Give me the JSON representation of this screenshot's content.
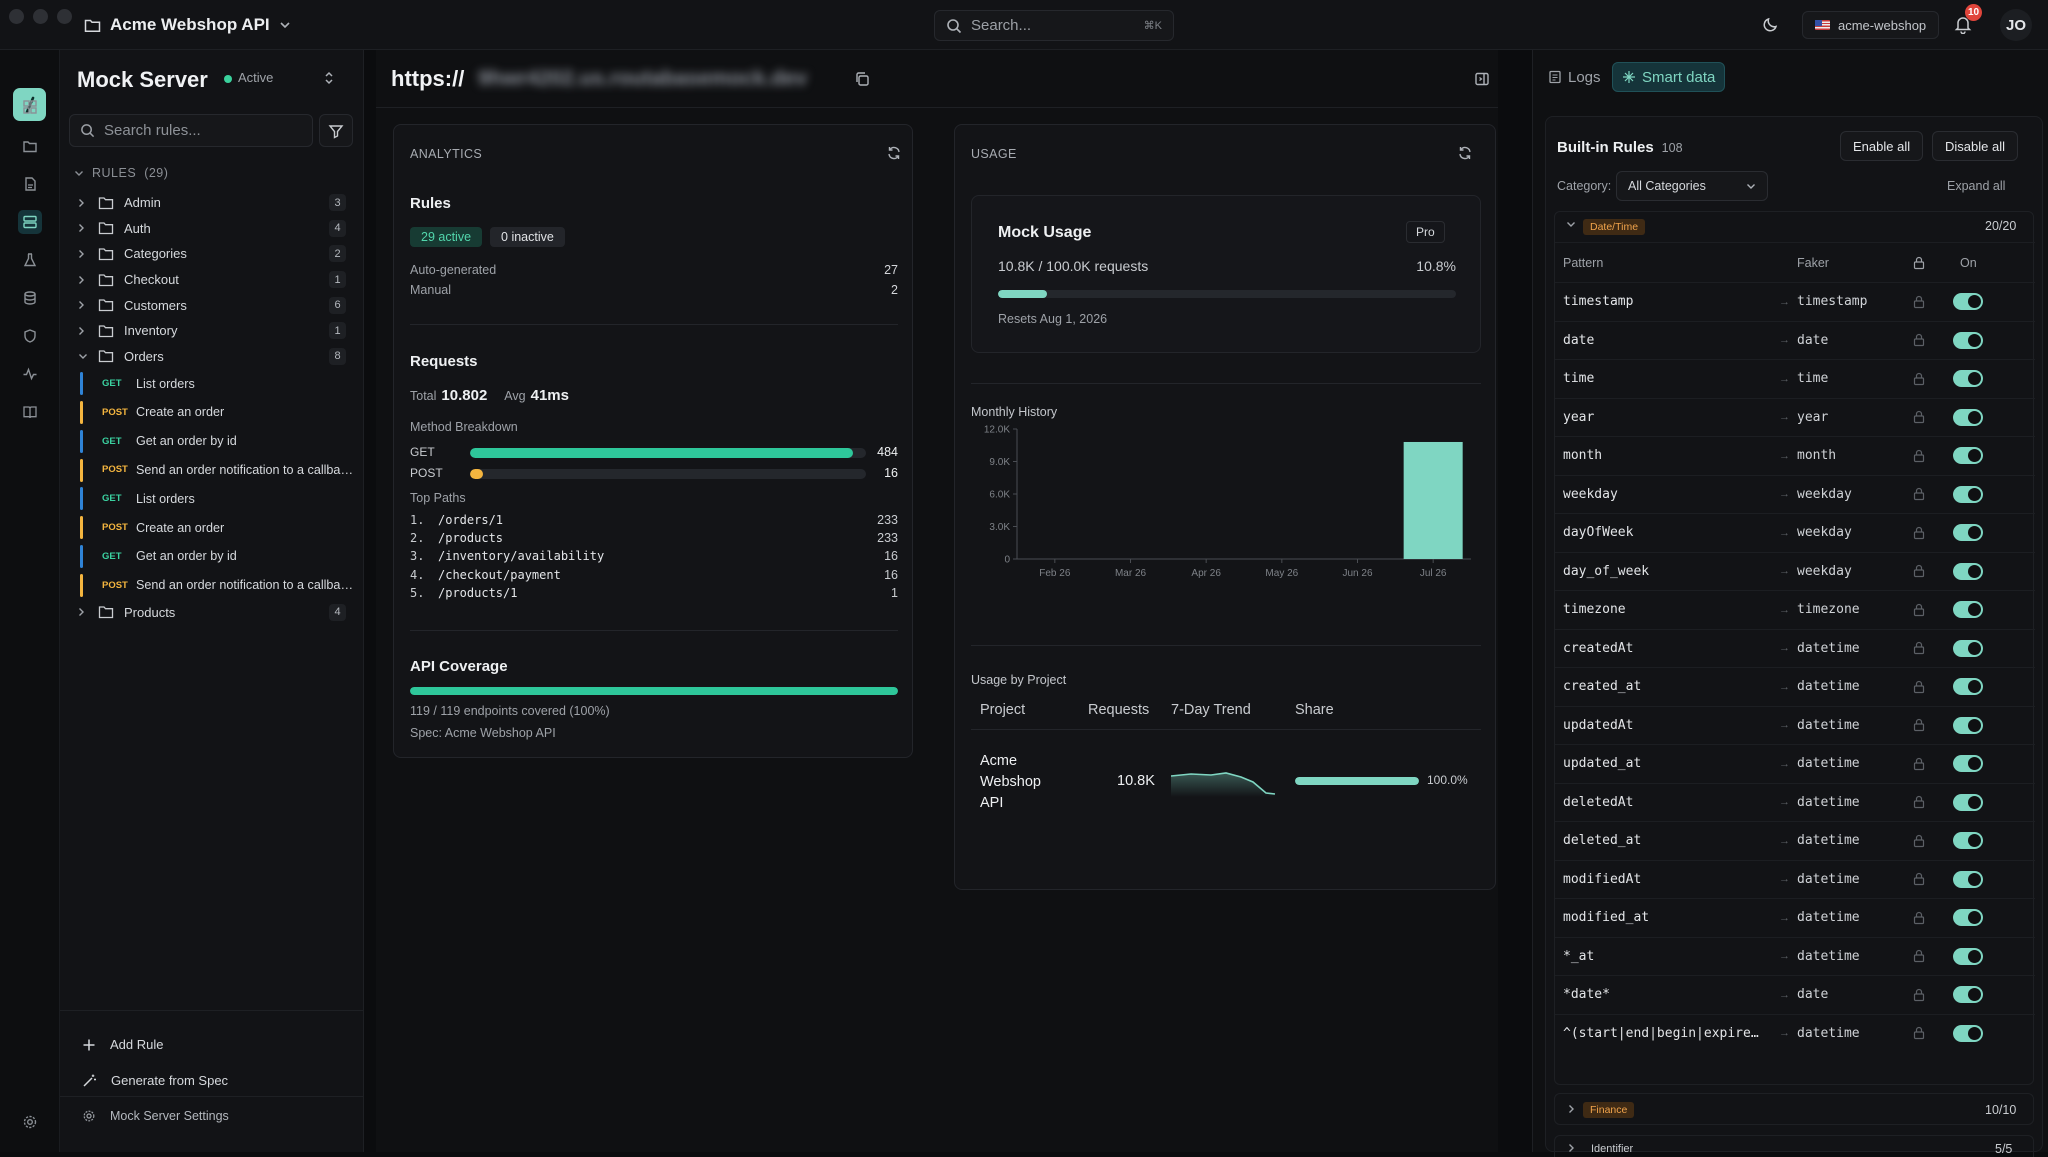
{
  "app": {
    "title": "Acme Webshop API"
  },
  "search": {
    "placeholder": "Search...",
    "shortcut": "⌘K"
  },
  "header": {
    "workspace": "acme-webshop",
    "notifications": "10",
    "avatar": "JO"
  },
  "sidebar": {
    "server_name": "Mock Server",
    "status": "Active",
    "search_placeholder": "Search rules...",
    "rules_label": "RULES",
    "rules_count": "(29)",
    "folders_top": [
      {
        "name": "Admin",
        "count": "3"
      },
      {
        "name": "Auth",
        "count": "4"
      },
      {
        "name": "Categories",
        "count": "2"
      },
      {
        "name": "Checkout",
        "count": "1"
      },
      {
        "name": "Customers",
        "count": "6"
      },
      {
        "name": "Inventory",
        "count": "1"
      },
      {
        "name": "Orders",
        "count": "8"
      }
    ],
    "order_rules": [
      {
        "method": "GET",
        "name": "List orders"
      },
      {
        "method": "POST",
        "name": "Create an order"
      },
      {
        "method": "GET",
        "name": "Get an order by id"
      },
      {
        "method": "POST",
        "name": "Send an order notification to a callback URL"
      },
      {
        "method": "GET",
        "name": "List orders"
      },
      {
        "method": "POST",
        "name": "Create an order"
      },
      {
        "method": "GET",
        "name": "Get an order by id"
      },
      {
        "method": "POST",
        "name": "Send an order notification to a callback URL"
      }
    ],
    "folders_bottom": [
      {
        "name": "Products",
        "count": "4"
      }
    ],
    "add_rule": "Add Rule",
    "generate": "Generate from Spec",
    "settings": "Mock Server Settings"
  },
  "url": {
    "prefix": "https://",
    "host": "9hwr4202.us.routabasemock.dev"
  },
  "analytics": {
    "caption": "ANALYTICS",
    "rules_title": "Rules",
    "active": "29 active",
    "inactive": "0 inactive",
    "auto_label": "Auto-generated",
    "auto_value": "27",
    "manual_label": "Manual",
    "manual_value": "2",
    "requests_title": "Requests",
    "total_label": "Total",
    "total_value": "10.802",
    "avg_label": "Avg",
    "avg_value": "41ms",
    "breakdown_label": "Method Breakdown",
    "methods": [
      {
        "name": "GET",
        "value": "484",
        "pct": 0.968,
        "color": "#2ec79a"
      },
      {
        "name": "POST",
        "value": "16",
        "pct": 0.032,
        "color": "#f4b53f"
      }
    ],
    "top_paths_label": "Top Paths",
    "top_paths": [
      {
        "rank": "1.",
        "path": "/orders/1",
        "count": "233"
      },
      {
        "rank": "2.",
        "path": "/products",
        "count": "233"
      },
      {
        "rank": "3.",
        "path": "/inventory/availability",
        "count": "16"
      },
      {
        "rank": "4.",
        "path": "/checkout/payment",
        "count": "16"
      },
      {
        "rank": "5.",
        "path": "/products/1",
        "count": "1"
      }
    ],
    "coverage_title": "API Coverage",
    "coverage_pct": 1.0,
    "coverage_text": "119 / 119 endpoints covered (100%)",
    "spec_text": "Spec: Acme Webshop API"
  },
  "usage": {
    "caption": "USAGE",
    "mock_title": "Mock Usage",
    "plan": "Pro",
    "requests_text": "10.8K / 100.0K requests",
    "pct_text": "10.8%",
    "pct": 0.108,
    "resets": "Resets Aug 1, 2026",
    "history_title": "Monthly History",
    "by_project_title": "Usage by Project",
    "columns": [
      "Project",
      "Requests",
      "7-Day Trend",
      "Share"
    ],
    "project": {
      "name_lines": [
        "Acme",
        "Webshop",
        "API"
      ],
      "requests": "10.8K",
      "share_text": "100.0%",
      "share": 1.0
    }
  },
  "chart_data": {
    "type": "bar",
    "title": "Monthly History",
    "categories": [
      "Feb 26",
      "Mar 26",
      "Apr 26",
      "May 26",
      "Jun 26",
      "Jul 26"
    ],
    "values": [
      0,
      0,
      0,
      0,
      0,
      10802
    ],
    "yticks": [
      "0",
      "3.0K",
      "6.0K",
      "9.0K",
      "12.0K"
    ],
    "ylim": [
      0,
      12000
    ],
    "color": "#7fd6c2",
    "grid": false
  },
  "right": {
    "tab_logs": "Logs",
    "tab_smart": "Smart data",
    "title": "Built-in Rules",
    "count": "108",
    "enable_all": "Enable all",
    "disable_all": "Disable all",
    "category_label": "Category:",
    "category_value": "All Categories",
    "expand_all": "Expand all",
    "group_open": {
      "name": "Date/Time",
      "count": "20/20"
    },
    "headers": {
      "pattern": "Pattern",
      "faker": "Faker",
      "on": "On"
    },
    "rows": [
      {
        "pattern": "timestamp",
        "faker": "timestamp"
      },
      {
        "pattern": "date",
        "faker": "date"
      },
      {
        "pattern": "time",
        "faker": "time"
      },
      {
        "pattern": "year",
        "faker": "year"
      },
      {
        "pattern": "month",
        "faker": "month"
      },
      {
        "pattern": "weekday",
        "faker": "weekday"
      },
      {
        "pattern": "dayOfWeek",
        "faker": "weekday"
      },
      {
        "pattern": "day_of_week",
        "faker": "weekday"
      },
      {
        "pattern": "timezone",
        "faker": "timezone"
      },
      {
        "pattern": "createdAt",
        "faker": "datetime"
      },
      {
        "pattern": "created_at",
        "faker": "datetime"
      },
      {
        "pattern": "updatedAt",
        "faker": "datetime"
      },
      {
        "pattern": "updated_at",
        "faker": "datetime"
      },
      {
        "pattern": "deletedAt",
        "faker": "datetime"
      },
      {
        "pattern": "deleted_at",
        "faker": "datetime"
      },
      {
        "pattern": "modifiedAt",
        "faker": "datetime"
      },
      {
        "pattern": "modified_at",
        "faker": "datetime"
      },
      {
        "pattern": "*_at",
        "faker": "datetime"
      },
      {
        "pattern": "*date*",
        "faker": "date"
      },
      {
        "pattern": "^(start|end|begin|expire…",
        "faker": "datetime"
      }
    ],
    "group_finance": {
      "name": "Finance",
      "count": "10/10"
    },
    "group_identifier": {
      "name": "Identifier",
      "count": "5/5"
    }
  }
}
